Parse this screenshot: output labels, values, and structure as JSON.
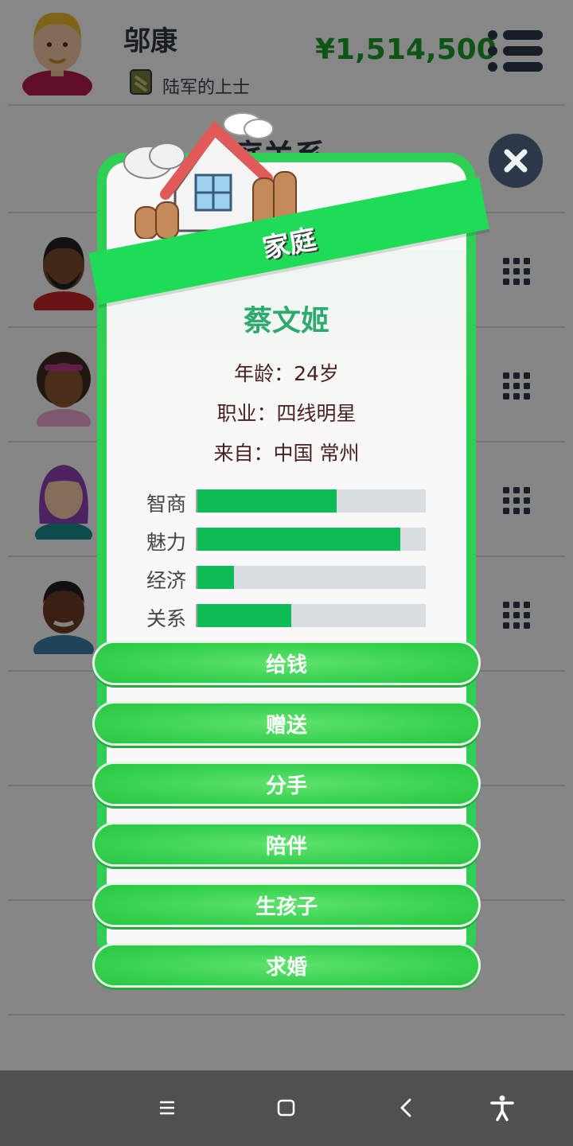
{
  "header": {
    "player_name": "邬康",
    "rank": "陆军的上士",
    "money": "¥1,514,500"
  },
  "background": {
    "title": "家庭关系",
    "list_count": 4
  },
  "card": {
    "banner": "家庭",
    "name": "蔡文姬",
    "age": "年龄：24岁",
    "job": "职业：四线明星",
    "origin": "来自：中国 常州",
    "stats": [
      {
        "label": "智商",
        "value": 0.61
      },
      {
        "label": "魅力",
        "value": 0.89
      },
      {
        "label": "经济",
        "value": 0.16
      },
      {
        "label": "关系",
        "value": 0.41
      }
    ],
    "actions": [
      "给钱",
      "赠送",
      "分手",
      "陪伴",
      "生孩子",
      "求婚"
    ]
  },
  "colors": {
    "accent": "#1edc55",
    "money": "#1a9a2a",
    "name": "#2eaa70",
    "bar_fill": "#0cbc55"
  },
  "icons": [
    "menu-icon",
    "close-icon",
    "grid-icon",
    "home-icon",
    "recents-icon",
    "back-icon",
    "accessibility-icon"
  ]
}
